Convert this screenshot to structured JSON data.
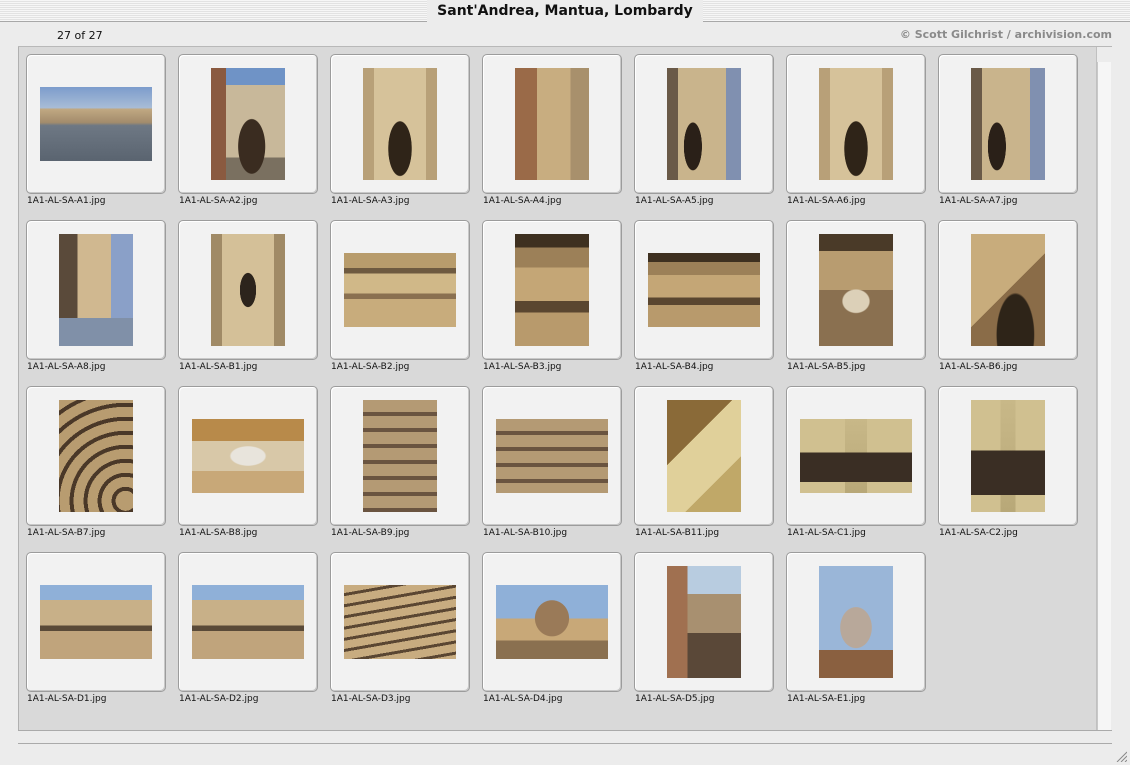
{
  "window": {
    "title": "Sant'Andrea, Mantua, Lombardy"
  },
  "header": {
    "count": "27 of 27",
    "copyright": "© Scott Gilchrist / archivision.com"
  },
  "thumbnails": [
    {
      "file": "1A1-AL-SA-A1.jpg",
      "orientation": "landscape",
      "scene": "piazza-view"
    },
    {
      "file": "1A1-AL-SA-A2.jpg",
      "orientation": "portrait",
      "scene": "facade-tower"
    },
    {
      "file": "1A1-AL-SA-A3.jpg",
      "orientation": "portrait",
      "scene": "facade-arch"
    },
    {
      "file": "1A1-AL-SA-A4.jpg",
      "orientation": "portrait",
      "scene": "facade-side"
    },
    {
      "file": "1A1-AL-SA-A5.jpg",
      "orientation": "portrait",
      "scene": "facade-oblique"
    },
    {
      "file": "1A1-AL-SA-A6.jpg",
      "orientation": "portrait",
      "scene": "facade-arch"
    },
    {
      "file": "1A1-AL-SA-A7.jpg",
      "orientation": "portrait",
      "scene": "facade-oblique"
    },
    {
      "file": "1A1-AL-SA-A8.jpg",
      "orientation": "portrait",
      "scene": "porch-steps"
    },
    {
      "file": "1A1-AL-SA-B1.jpg",
      "orientation": "portrait",
      "scene": "bay-window"
    },
    {
      "file": "1A1-AL-SA-B2.jpg",
      "orientation": "landscape",
      "scene": "entablature"
    },
    {
      "file": "1A1-AL-SA-B3.jpg",
      "orientation": "portrait",
      "scene": "cornice"
    },
    {
      "file": "1A1-AL-SA-B4.jpg",
      "orientation": "landscape",
      "scene": "cornice"
    },
    {
      "file": "1A1-AL-SA-B5.jpg",
      "orientation": "portrait",
      "scene": "capital"
    },
    {
      "file": "1A1-AL-SA-B6.jpg",
      "orientation": "portrait",
      "scene": "arch-soffit"
    },
    {
      "file": "1A1-AL-SA-B7.jpg",
      "orientation": "portrait",
      "scene": "coffered-arch"
    },
    {
      "file": "1A1-AL-SA-B8.jpg",
      "orientation": "landscape",
      "scene": "capital-close"
    },
    {
      "file": "1A1-AL-SA-B9.jpg",
      "orientation": "portrait",
      "scene": "carved-panel"
    },
    {
      "file": "1A1-AL-SA-B10.jpg",
      "orientation": "landscape",
      "scene": "carved-panel"
    },
    {
      "file": "1A1-AL-SA-B11.jpg",
      "orientation": "portrait",
      "scene": "vault-corner"
    },
    {
      "file": "1A1-AL-SA-C1.jpg",
      "orientation": "landscape",
      "scene": "doorway"
    },
    {
      "file": "1A1-AL-SA-C2.jpg",
      "orientation": "portrait",
      "scene": "doorway"
    },
    {
      "file": "1A1-AL-SA-D1.jpg",
      "orientation": "landscape",
      "scene": "pediment"
    },
    {
      "file": "1A1-AL-SA-D2.jpg",
      "orientation": "landscape",
      "scene": "pediment"
    },
    {
      "file": "1A1-AL-SA-D3.jpg",
      "orientation": "landscape",
      "scene": "cornice-oblique"
    },
    {
      "file": "1A1-AL-SA-D4.jpg",
      "orientation": "landscape",
      "scene": "pediment-arch"
    },
    {
      "file": "1A1-AL-SA-D5.jpg",
      "orientation": "portrait",
      "scene": "bell-tower"
    },
    {
      "file": "1A1-AL-SA-E1.jpg",
      "orientation": "portrait",
      "scene": "dome"
    }
  ],
  "icons": {
    "resize": "resize-grip-icon"
  },
  "colors": {
    "sky": "#6f93c6",
    "stone": "#b09468",
    "shadow": "#3a2c1c",
    "warm": "#d2b26e"
  }
}
